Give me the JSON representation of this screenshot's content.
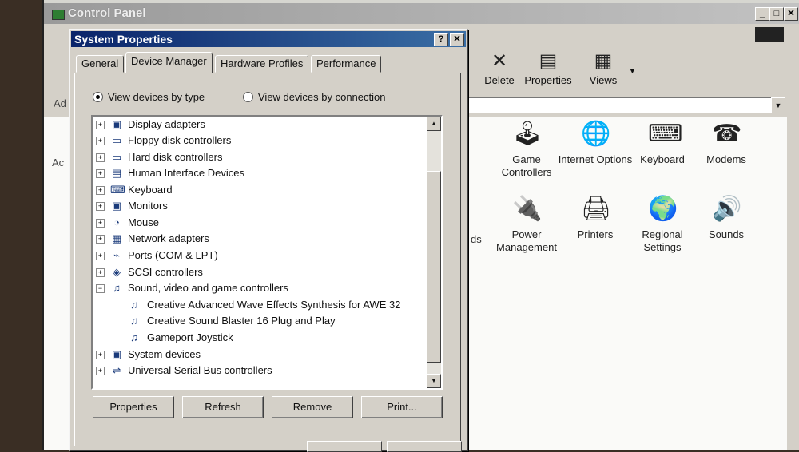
{
  "control_panel": {
    "title": "Control Panel",
    "toolbar": {
      "delete_label": "Delete",
      "properties_label": "Properties",
      "views_label": "Views"
    },
    "address_label_partial": "Ad",
    "left_pane_partial": "Ac",
    "cutoff_text": "ds",
    "items": [
      {
        "label": "Game Controllers",
        "icon": "joystick-icon"
      },
      {
        "label": "Internet Options",
        "icon": "globe-icon"
      },
      {
        "label": "Keyboard",
        "icon": "keyboard-icon"
      },
      {
        "label": "Modems",
        "icon": "modem-icon"
      },
      {
        "label": "Power Management",
        "icon": "power-icon"
      },
      {
        "label": "Printers",
        "icon": "printer-folder-icon"
      },
      {
        "label": "Regional Settings",
        "icon": "globe-icon"
      },
      {
        "label": "Sounds",
        "icon": "speaker-icon"
      }
    ]
  },
  "dialog": {
    "title": "System Properties",
    "help_glyph": "?",
    "close_glyph": "✕",
    "tabs": [
      "General",
      "Device Manager",
      "Hardware Profiles",
      "Performance"
    ],
    "active_tab": "Device Manager",
    "radio_by_type": "View devices by type",
    "radio_by_connection": "View devices by connection",
    "tree": [
      {
        "label": "Display adapters",
        "expanded": false,
        "level": 0
      },
      {
        "label": "Floppy disk controllers",
        "expanded": false,
        "level": 0
      },
      {
        "label": "Hard disk controllers",
        "expanded": false,
        "level": 0
      },
      {
        "label": "Human Interface Devices",
        "expanded": false,
        "level": 0
      },
      {
        "label": "Keyboard",
        "expanded": false,
        "level": 0
      },
      {
        "label": "Monitors",
        "expanded": false,
        "level": 0
      },
      {
        "label": "Mouse",
        "expanded": false,
        "level": 0
      },
      {
        "label": "Network adapters",
        "expanded": false,
        "level": 0
      },
      {
        "label": "Ports (COM & LPT)",
        "expanded": false,
        "level": 0
      },
      {
        "label": "SCSI controllers",
        "expanded": false,
        "level": 0
      },
      {
        "label": "Sound, video and game controllers",
        "expanded": true,
        "level": 0
      },
      {
        "label": "Creative Advanced Wave Effects Synthesis for AWE 32",
        "level": 1
      },
      {
        "label": "Creative Sound Blaster 16 Plug and Play",
        "level": 1
      },
      {
        "label": "Gameport Joystick",
        "level": 1
      },
      {
        "label": "System devices",
        "expanded": false,
        "level": 0
      },
      {
        "label": "Universal Serial Bus controllers",
        "expanded": false,
        "level": 0
      }
    ],
    "buttons": {
      "properties": "Properties",
      "refresh": "Refresh",
      "remove": "Remove",
      "print": "Print..."
    }
  },
  "colors": {
    "title_active": "#0a246a",
    "face": "#d4d0c8"
  }
}
